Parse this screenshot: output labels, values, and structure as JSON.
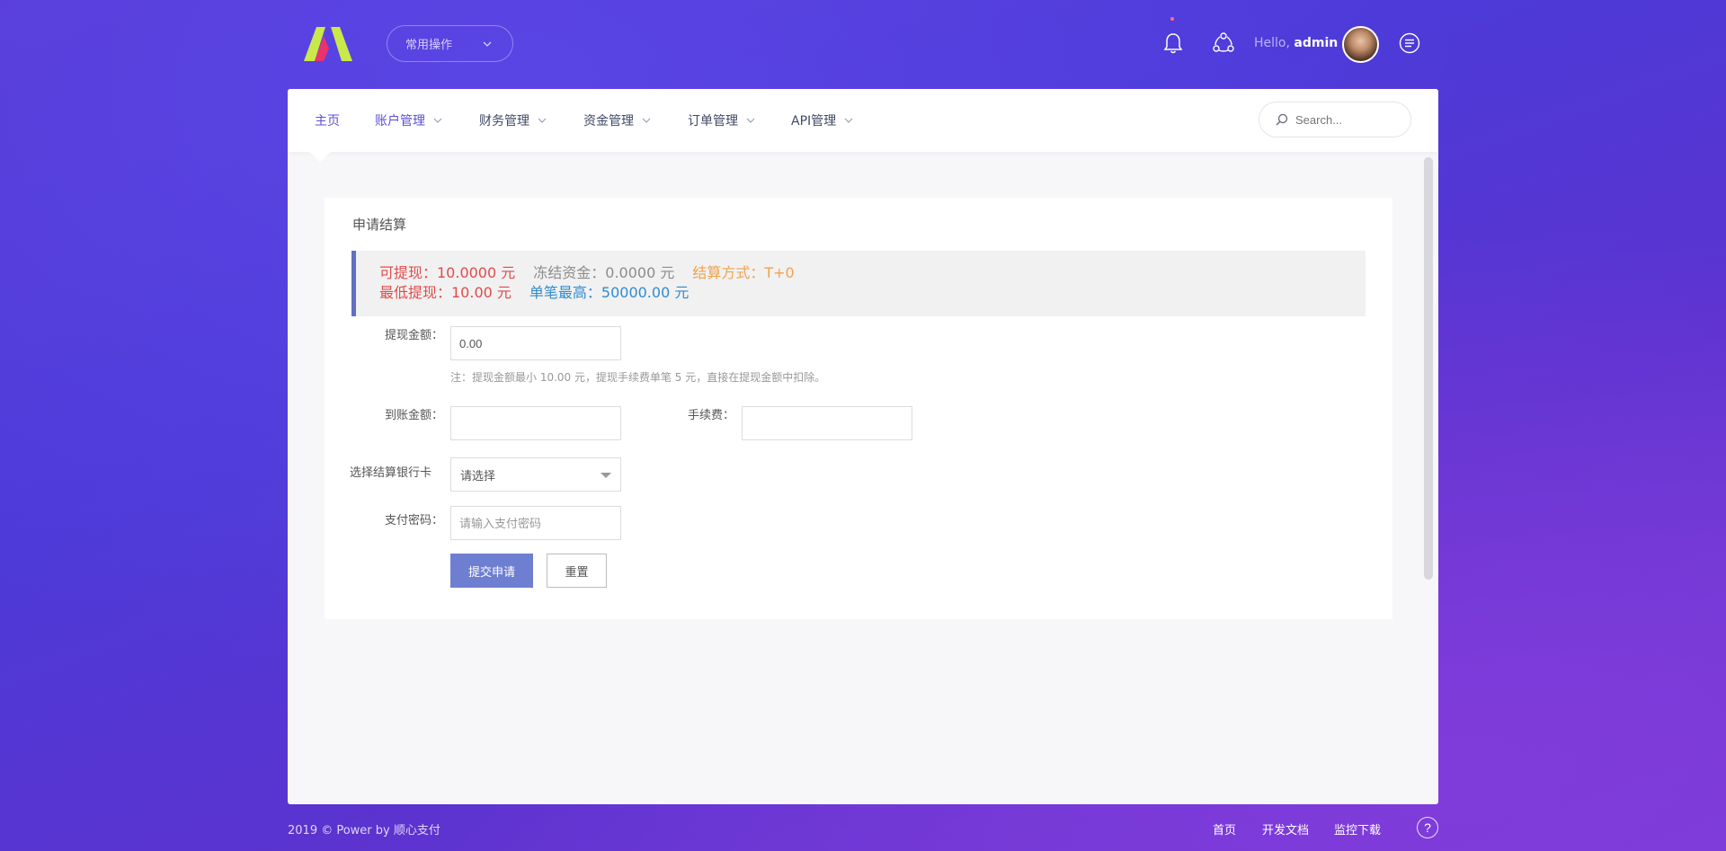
{
  "header": {
    "quick_select_label": "常用操作",
    "greeting": "Hello,",
    "username": "admin"
  },
  "nav": {
    "items": [
      {
        "label": "主页",
        "has_dropdown": false
      },
      {
        "label": "账户管理",
        "has_dropdown": true
      },
      {
        "label": "财务管理",
        "has_dropdown": true
      },
      {
        "label": "资金管理",
        "has_dropdown": true
      },
      {
        "label": "订单管理",
        "has_dropdown": true
      },
      {
        "label": "API管理",
        "has_dropdown": true
      }
    ],
    "search_placeholder": "Search..."
  },
  "card": {
    "title": "申请结算"
  },
  "alert": {
    "withdrawable": "可提现：10.0000 元",
    "frozen": "冻结资金：0.0000 元",
    "settle_mode": "结算方式：T+0",
    "min_withdraw": "最低提现：10.00 元",
    "max_single": "单笔最高：50000.00 元"
  },
  "form": {
    "amount_label": "提现金额：",
    "amount_value": "0.00",
    "amount_hint": "注：提现金额最小 10.00 元，提现手续费单笔 5 元，直接在提现金额中扣除。",
    "received_label": "到账金额：",
    "received_value": "",
    "fee_label": "手续费：",
    "fee_value": "",
    "bank_label": "选择结算银行卡",
    "bank_selected": "请选择",
    "password_label": "支付密码：",
    "password_placeholder": "请输入支付密码",
    "submit_label": "提交申请",
    "reset_label": "重置"
  },
  "footer": {
    "copyright": "2019 © Power by 顺心支付",
    "links": [
      "首页",
      "开发文档",
      "监控下载"
    ],
    "help_symbol": "?"
  },
  "colors": {
    "accent": "#5e4fd8",
    "alert_red": "#e24a4a",
    "alert_orange": "#f0a24e",
    "alert_blue": "#2f8ccf",
    "button_primary": "#6e7fd1"
  }
}
